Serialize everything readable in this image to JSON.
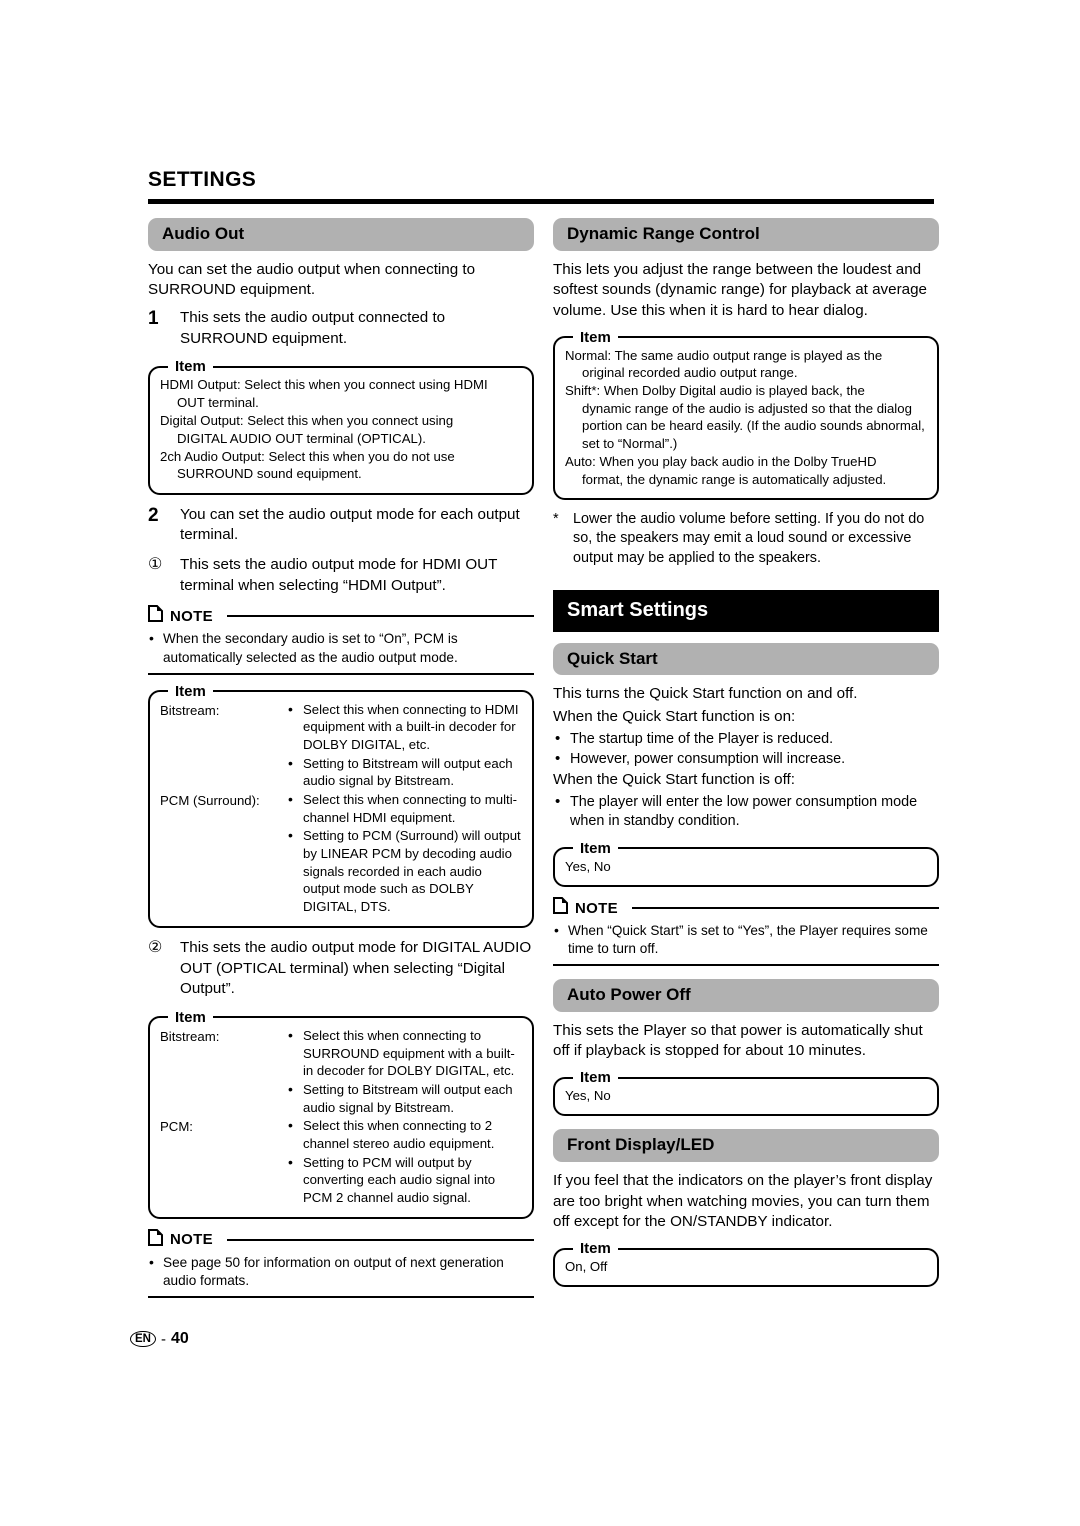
{
  "page": {
    "section_title": "SETTINGS",
    "footer_lang": "EN",
    "footer_dash": "-",
    "footer_page": "40"
  },
  "labels": {
    "item": "Item",
    "note": "NOTE"
  },
  "left": {
    "audio_out": {
      "heading": "Audio Out",
      "intro": "You can set the audio output when connecting to SURROUND equipment.",
      "step1_num": "1",
      "step1_text": "This sets the audio output connected to SURROUND equipment.",
      "item1": {
        "lines": [
          {
            "main": "HDMI Output: Select this when you connect using HDMI",
            "cont": "OUT terminal."
          },
          {
            "main": "Digital Output: Select this when you connect using",
            "cont": "DIGITAL AUDIO OUT terminal (OPTICAL)."
          },
          {
            "main": "2ch Audio Output: Select this when you do not use",
            "cont": "SURROUND sound equipment."
          }
        ]
      },
      "step2_num": "2",
      "step2_text": "You can set the audio output mode for each output terminal.",
      "sub1_num": "①",
      "sub1_text": "This sets the audio output mode for HDMI OUT terminal when selecting “HDMI Output”.",
      "note1": "When the secondary audio is set to “On”, PCM is automatically selected as the audio output mode.",
      "item2": {
        "rows": [
          {
            "label": "Bitstream:",
            "bullets": [
              "Select this when connecting to HDMI equipment with a built-in decoder for DOLBY DIGITAL, etc.",
              "Setting to Bitstream will output each audio signal by Bitstream."
            ]
          },
          {
            "label": "PCM (Surround):",
            "bullets": [
              "Select this when connecting to multi-channel HDMI equipment.",
              "Setting to PCM (Surround) will output by LINEAR PCM by decoding audio signals recorded in each audio output mode such as DOLBY DIGITAL, DTS."
            ]
          }
        ]
      },
      "sub2_num": "②",
      "sub2_text": "This sets the audio output mode for DIGITAL AUDIO OUT (OPTICAL terminal) when selecting “Digital Output”.",
      "item3": {
        "rows": [
          {
            "label": "Bitstream:",
            "bullets": [
              "Select this when connecting to SURROUND equipment with a built-in decoder for DOLBY DIGITAL, etc.",
              "Setting to Bitstream will output each audio signal by Bitstream."
            ]
          },
          {
            "label": "PCM:",
            "bullets": [
              "Select this when connecting to 2 channel stereo audio equipment.",
              "Setting to PCM will output by converting each audio signal into PCM 2 channel audio signal."
            ]
          }
        ]
      },
      "note2": "See page 50 for information on output of next generation audio formats."
    }
  },
  "right": {
    "dynamic_range": {
      "heading": "Dynamic Range Control",
      "intro": "This lets you adjust the range between the loudest and softest sounds (dynamic range) for playback at average volume. Use this when it is hard to hear dialog.",
      "item": {
        "lines": [
          {
            "main": "Normal: The same audio output range is played as the",
            "cont": "original recorded audio output range."
          },
          {
            "main": "Shift*: When Dolby Digital audio is played back, the",
            "cont": "dynamic range of the audio is adjusted so that the dialog portion can be heard easily. (If the audio sounds abnormal, set to “Normal”.)"
          },
          {
            "main": "Auto: When you play back audio in the Dolby TrueHD",
            "cont": "format, the dynamic range is automatically adjusted."
          }
        ]
      },
      "footnote_star": "*",
      "footnote_text": "Lower the audio volume before setting. If you do not do so, the speakers may emit a loud sound or excessive output may be applied to the speakers."
    },
    "smart_settings": {
      "banner": "Smart Settings"
    },
    "quick_start": {
      "heading": "Quick Start",
      "line1": "This turns the Quick Start function on and off.",
      "line2": "When the Quick Start function is on:",
      "bullets_on": [
        "The startup time of the Player is reduced.",
        "However, power consumption will increase."
      ],
      "line3": "When the Quick Start function is off:",
      "bullets_off": [
        "The player will enter the low power consumption mode when in standby condition."
      ],
      "item_values": "Yes, No",
      "note": "When “Quick Start” is set to “Yes”, the Player requires some time to turn off."
    },
    "auto_power_off": {
      "heading": "Auto Power Off",
      "intro": "This sets the Player so that power is automatically shut off if playback is stopped for about 10 minutes.",
      "item_values": "Yes, No"
    },
    "front_display": {
      "heading": "Front Display/LED",
      "intro": "If you feel that the indicators on the player’s front display are too bright when watching movies, you can turn them off except for the ON/STANDBY indicator.",
      "item_values": "On, Off"
    }
  }
}
